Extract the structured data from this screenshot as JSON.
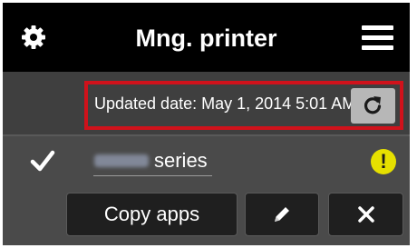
{
  "header": {
    "title": "Mng. printer",
    "settings_icon": "gear-icon",
    "menu_icon": "hamburger-menu-icon"
  },
  "update": {
    "text": "Updated date: May 1, 2014 5:01 AM",
    "refresh_icon": "refresh-icon"
  },
  "printer": {
    "model_suffix": "series",
    "selected_icon": "checkmark-icon",
    "status_icon": "warning-icon",
    "status_symbol": "!"
  },
  "actions": {
    "copy_label": "Copy apps",
    "edit_icon": "pencil-icon",
    "delete_icon": "close-icon"
  },
  "colors": {
    "header_bg": "#000000",
    "panel_bg": "#3f3f3f",
    "highlight": "#d0121b",
    "warning": "#e6e000"
  }
}
